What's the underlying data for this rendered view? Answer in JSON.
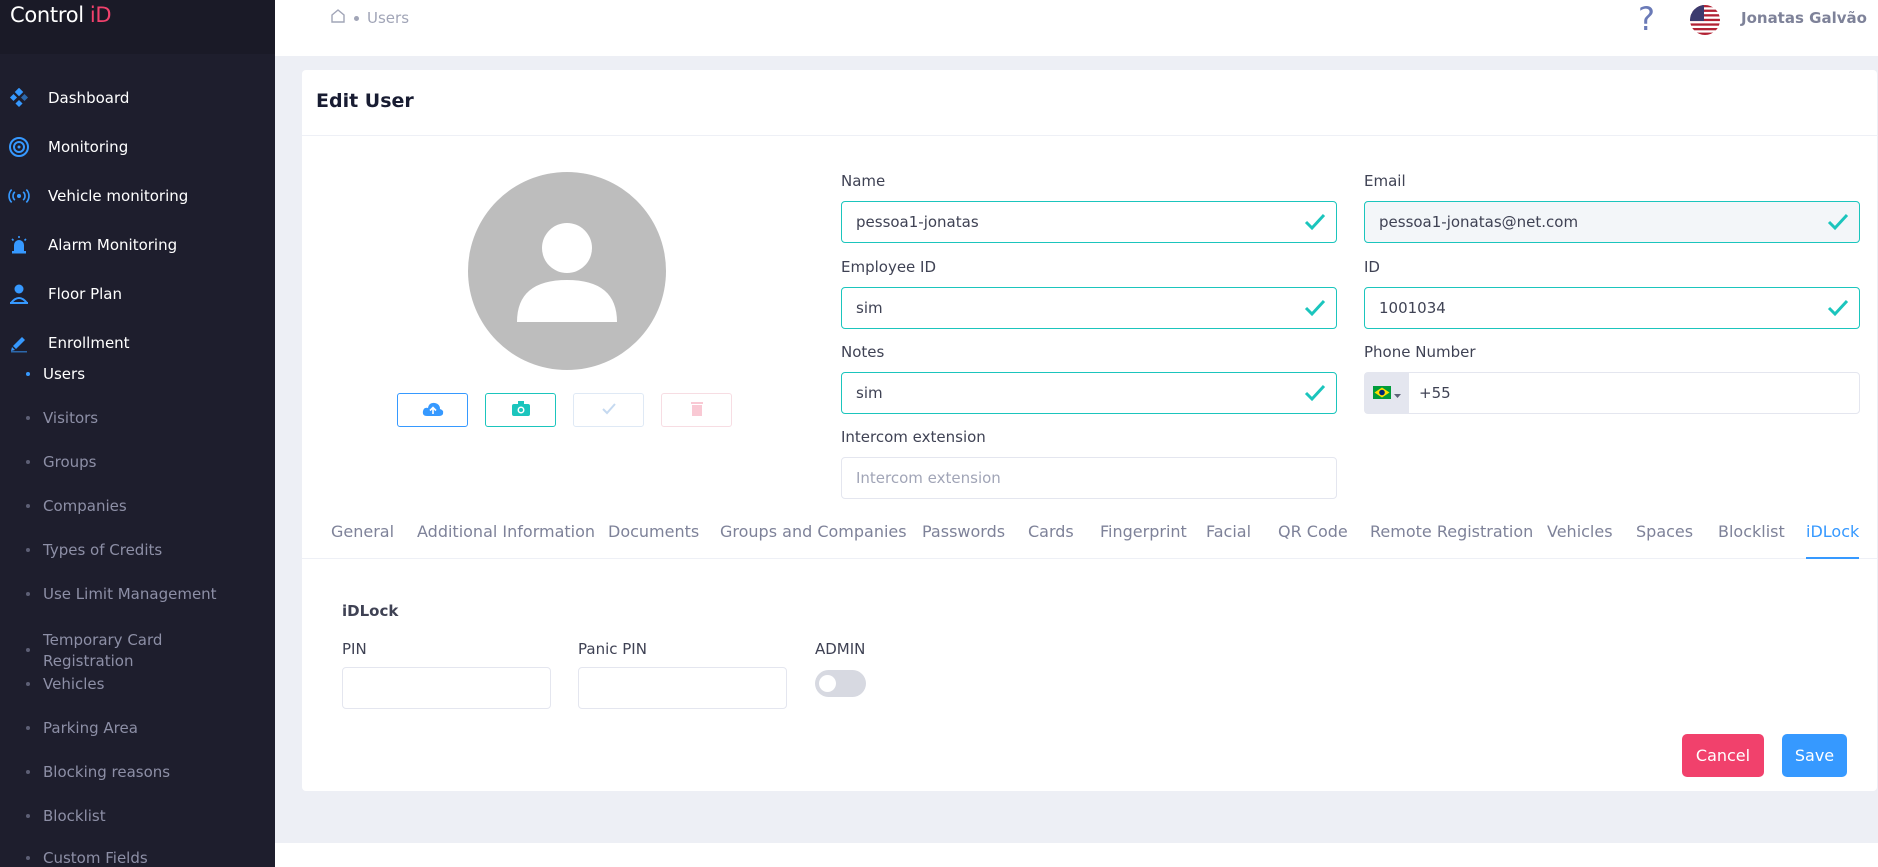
{
  "brand": {
    "name": "Control",
    "accent": "iD"
  },
  "sidebar": {
    "main": [
      {
        "label": "Dashboard",
        "icon": "dashboard-icon"
      },
      {
        "label": "Monitoring",
        "icon": "monitoring-icon"
      },
      {
        "label": "Vehicle monitoring",
        "icon": "vehicle-monitoring-icon"
      },
      {
        "label": "Alarm Monitoring",
        "icon": "alarm-icon"
      },
      {
        "label": "Floor Plan",
        "icon": "floor-plan-icon"
      },
      {
        "label": "Enrollment",
        "icon": "enrollment-icon"
      }
    ],
    "sub": [
      {
        "label": "Users",
        "active": true
      },
      {
        "label": "Visitors"
      },
      {
        "label": "Groups"
      },
      {
        "label": "Companies"
      },
      {
        "label": "Types of Credits"
      },
      {
        "label": "Use Limit Management"
      },
      {
        "label": "Temporary Card Registration"
      },
      {
        "label": "Vehicles"
      },
      {
        "label": "Parking Area"
      },
      {
        "label": "Blocking reasons"
      },
      {
        "label": "Blocklist"
      },
      {
        "label": "Custom Fields"
      }
    ]
  },
  "header": {
    "breadcrumb": "Users",
    "help": "?",
    "user": "Jonatas Galvão"
  },
  "page": {
    "title": "Edit User"
  },
  "form": {
    "name": {
      "label": "Name",
      "value": "pessoa1-jonatas"
    },
    "email": {
      "label": "Email",
      "value": "pessoa1-jonatas@net.com"
    },
    "employee_id": {
      "label": "Employee ID",
      "value": "sim"
    },
    "id": {
      "label": "ID",
      "value": "1001034"
    },
    "notes": {
      "label": "Notes",
      "value": "sim"
    },
    "phone": {
      "label": "Phone Number",
      "value": "+55"
    },
    "intercom": {
      "label": "Intercom extension",
      "placeholder": "Intercom extension"
    }
  },
  "tabs": [
    "General",
    "Additional Information",
    "Documents",
    "Groups and Companies",
    "Passwords",
    "Cards",
    "Fingerprint",
    "Facial",
    "QR Code",
    "Remote Registration",
    "Vehicles",
    "Spaces",
    "Blocklist",
    "iDLock"
  ],
  "active_tab": "iDLock",
  "idlock": {
    "title": "iDLock",
    "pin_label": "PIN",
    "panic_pin_label": "Panic PIN",
    "admin_label": "ADMIN",
    "admin_enabled": false
  },
  "actions": {
    "cancel": "Cancel",
    "save": "Save"
  },
  "colors": {
    "primary": "#3699ff",
    "success": "#1bc5bd",
    "danger": "#f1416c",
    "sidebar": "#1e1e2d"
  }
}
